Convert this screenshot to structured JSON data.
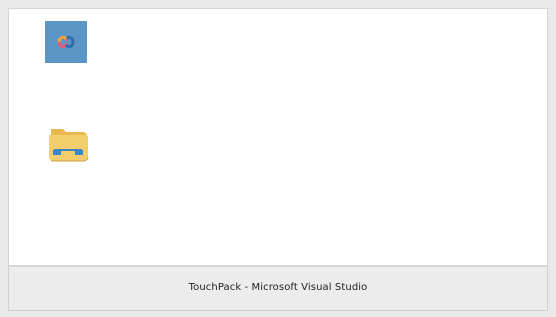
{
  "taskbar": {
    "status_text": "TouchPack - Microsoft Visual Studio"
  },
  "icons": [
    {
      "name": "visual-studio-icon"
    },
    {
      "name": "file-explorer-folder-icon"
    }
  ],
  "colors": {
    "window_bg": "#e9e9e9",
    "content_bg": "#ffffff",
    "vs_tile": "#5a97c7",
    "folder_yellow": "#f2cf6a",
    "folder_blue": "#3b86c8"
  }
}
